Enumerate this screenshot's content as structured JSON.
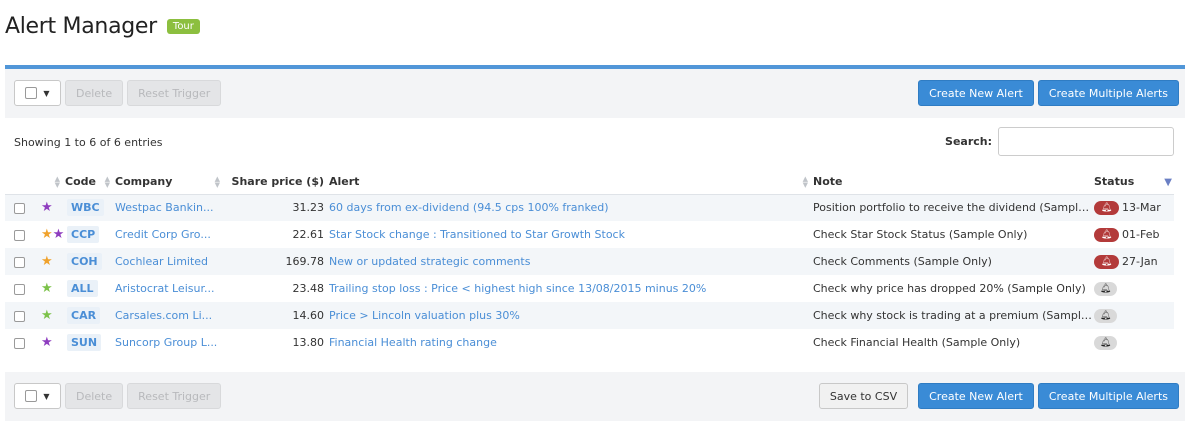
{
  "header": {
    "title": "Alert Manager",
    "tour_label": "Tour"
  },
  "toolbar": {
    "delete_label": "Delete",
    "reset_trigger_label": "Reset Trigger",
    "create_new_alert_label": "Create New Alert",
    "create_multiple_alerts_label": "Create Multiple Alerts",
    "save_csv_label": "Save to CSV"
  },
  "table_info": {
    "showing": "Showing 1 to 6 of 6 entries",
    "search_label": "Search:",
    "search_value": ""
  },
  "columns": {
    "code": "Code",
    "company": "Company",
    "share_price": "Share price ($)",
    "alert": "Alert",
    "note": "Note",
    "status": "Status"
  },
  "rows": [
    {
      "stars": [
        "purple"
      ],
      "code": "WBC",
      "company": "Westpac Bankin...",
      "price": "31.23",
      "alert": "60 days from ex-dividend (94.5 cps 100% franked)",
      "note": "Position portfolio to receive the dividend (Sample On...",
      "status_type": "triggered",
      "status_date": "13-Mar"
    },
    {
      "stars": [
        "orange",
        "purple"
      ],
      "code": "CCP",
      "company": "Credit Corp Gro...",
      "price": "22.61",
      "alert": "Star Stock change : Transitioned to Star Growth Stock",
      "note": "Check Star Stock Status (Sample Only)",
      "status_type": "triggered",
      "status_date": "01-Feb"
    },
    {
      "stars": [
        "orange"
      ],
      "code": "COH",
      "company": "Cochlear Limited",
      "price": "169.78",
      "alert": "New or updated strategic comments",
      "note": "Check Comments (Sample Only)",
      "status_type": "triggered",
      "status_date": "27-Jan"
    },
    {
      "stars": [
        "green"
      ],
      "code": "ALL",
      "company": "Aristocrat Leisur...",
      "price": "23.48",
      "alert": "Trailing stop loss : Price < highest high since 13/08/2015 minus 20%",
      "note": "Check why price has dropped 20% (Sample Only)",
      "status_type": "pending",
      "status_date": ""
    },
    {
      "stars": [
        "green"
      ],
      "code": "CAR",
      "company": "Carsales.com Li...",
      "price": "14.60",
      "alert": "Price > Lincoln valuation plus 30%",
      "note": "Check why stock is trading at a premium (Sample Only)",
      "status_type": "pending",
      "status_date": ""
    },
    {
      "stars": [
        "purple"
      ],
      "code": "SUN",
      "company": "Suncorp Group L...",
      "price": "13.80",
      "alert": "Financial Health rating change",
      "note": "Check Financial Health (Sample Only)",
      "status_type": "pending",
      "status_date": ""
    }
  ],
  "colors": {
    "accent": "#5196d8",
    "primary_button": "#3a8bd6",
    "link": "#4a8ed6",
    "triggered": "#b33a3a",
    "tour": "#8cbf3f"
  },
  "icons": {
    "star": "star-icon",
    "bell": "bell-icon",
    "caret": "caret-down-icon"
  }
}
